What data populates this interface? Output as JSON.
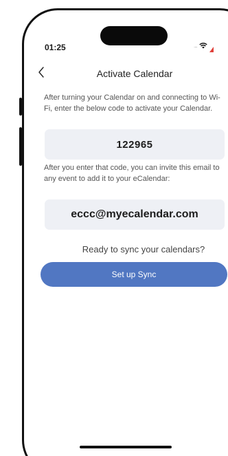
{
  "status_bar": {
    "time": "01:25",
    "signal": "....",
    "icons": [
      "wifi-icon",
      "battery-low-icon"
    ],
    "battery_color": "#e0403a"
  },
  "header": {
    "back_icon": "chevron-left-icon",
    "title": "Activate Calendar"
  },
  "main": {
    "instructions": "After turning your Calendar on and connecting to Wi-Fi, enter the below code to activate your Calendar.",
    "activation_code": "122965",
    "invite_text": "After you enter that code, you can invite this email to any event to add it to your eCalendar:",
    "calendar_email": "eccc@myecalendar.com",
    "sync_prompt": "Ready to sync your calendars?",
    "setup_button_label": "Set up Sync"
  },
  "colors": {
    "button_bg": "#5177c2",
    "info_box_bg": "#eef0f5",
    "text_primary": "#222222",
    "text_secondary": "#555555"
  }
}
